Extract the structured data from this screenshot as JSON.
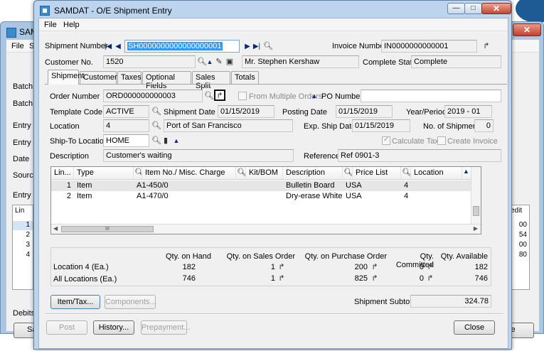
{
  "background_window": {
    "title": "SAM",
    "close": "✕",
    "menu": [
      "File",
      "S"
    ],
    "labels": [
      "Batch N",
      "Batch D",
      "Entry N",
      "Entry De",
      "Date",
      "Source",
      "Entry M",
      "Debits"
    ],
    "grid_header": "Lin",
    "grid_rows": [
      "1",
      "2",
      "3",
      "4"
    ],
    "right_header": "edit",
    "right_values": [
      "00",
      "54",
      "00",
      "80"
    ],
    "left_button": "Sa",
    "right_button": "le"
  },
  "window": {
    "title": "SAMDAT - O/E Shipment Entry",
    "minimize": "—",
    "maximize": "□",
    "close": "✕"
  },
  "menu": [
    "File",
    "Help"
  ],
  "header": {
    "shipment_number_label": "Shipment Number",
    "shipment_number": "SH0000000000000000001",
    "invoice_number_label": "Invoice Number",
    "invoice_number": "IN0000000000001",
    "customer_no_label": "Customer No.",
    "customer_no": "1520",
    "customer_name": "Mr. Stephen Kershaw",
    "complete_status_label": "Complete Status",
    "complete_status": "Complete"
  },
  "tabs": [
    "Shipment",
    "Customer",
    "Taxes",
    "Optional Fields",
    "Sales Split",
    "Totals"
  ],
  "form": {
    "order_number_label": "Order Number",
    "order_number": "ORD000000000003",
    "from_multiple_orders": "From Multiple Orders",
    "po_number_label": "PO Number",
    "po_number": "",
    "template_code_label": "Template Code",
    "template_code": "ACTIVE",
    "shipment_date_label": "Shipment Date",
    "shipment_date": "01/15/2019",
    "posting_date_label": "Posting Date",
    "posting_date": "01/15/2019",
    "year_period_label": "Year/Period",
    "year_period": "2019 - 01",
    "location_label": "Location",
    "location": "4",
    "location_name": "Port of San Francisco",
    "exp_ship_date_label": "Exp. Ship Date",
    "exp_ship_date": "01/15/2019",
    "no_of_shipments_label": "No. of Shipments",
    "no_of_shipments": "0",
    "ship_to_label": "Ship-To Location",
    "ship_to": "HOME",
    "calculate_tax": "Calculate Tax",
    "create_invoice": "Create Invoice",
    "description_label": "Description",
    "description": "Customer's waiting",
    "reference_label": "Reference",
    "reference": "Ref 0901-3"
  },
  "grid": {
    "headers": [
      "Lin...",
      "Type",
      "Item No./ Misc. Charge",
      "Kit/BOM",
      "Description",
      "Price List",
      "Location"
    ],
    "rows": [
      {
        "line": "1",
        "type": "Item",
        "item": "A1-450/0",
        "kit": "",
        "description": "Bulletin Board",
        "price_list": "USA",
        "location": "4"
      },
      {
        "line": "2",
        "type": "Item",
        "item": "A1-470/0",
        "kit": "",
        "description": "Dry-erase White ...",
        "price_list": "USA",
        "location": "4"
      }
    ],
    "hscroll_thumb": "III"
  },
  "summary": {
    "headers": [
      "Qty. on Hand",
      "Qty. on Sales Order",
      "Qty. on Purchase Order",
      "Qty. Committed",
      "Qty. Available"
    ],
    "rows": [
      {
        "label": "Location  4 (Ea.)",
        "values": [
          "182",
          "1",
          "200",
          "0",
          "182"
        ]
      },
      {
        "label": "All Locations (Ea.)",
        "values": [
          "746",
          "1",
          "825",
          "0",
          "746"
        ]
      }
    ]
  },
  "buttons": {
    "item_tax": "Item/Tax...",
    "components": "Components...",
    "shipment_subtotal_label": "Shipment Subtotal",
    "shipment_subtotal": "324.78",
    "post": "Post",
    "history": "History...",
    "prepayment": "Prepayment...",
    "close": "Close"
  }
}
